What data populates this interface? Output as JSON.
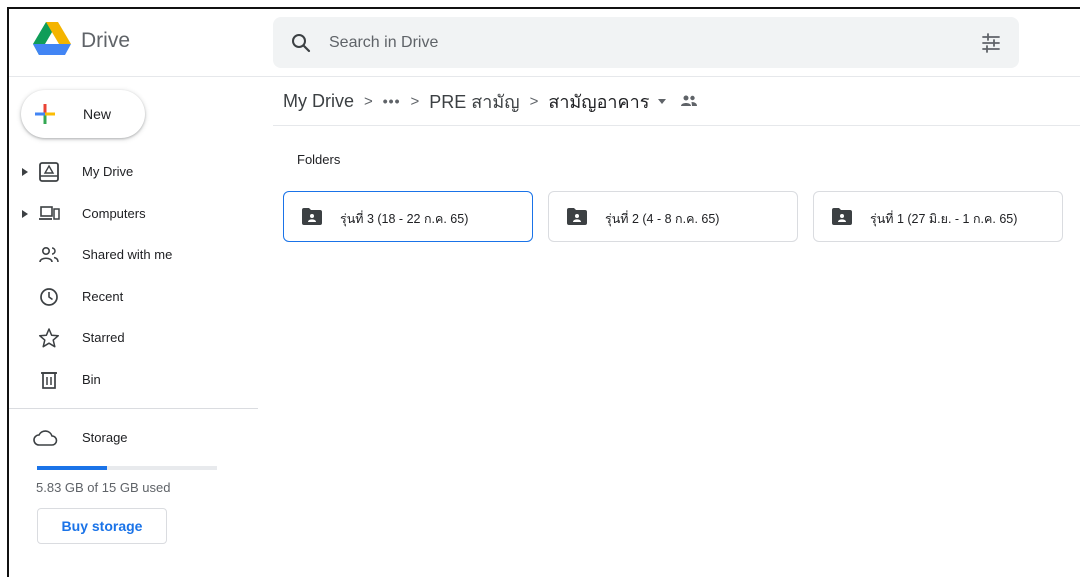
{
  "app": {
    "name": "Drive"
  },
  "search": {
    "placeholder": "Search in Drive"
  },
  "new_button": {
    "label": "New"
  },
  "sidebar": {
    "items": [
      {
        "label": "My Drive",
        "icon": "my-drive-icon",
        "expandable": true
      },
      {
        "label": "Computers",
        "icon": "computers-icon",
        "expandable": true
      },
      {
        "label": "Shared with me",
        "icon": "shared-icon",
        "expandable": false
      },
      {
        "label": "Recent",
        "icon": "clock-icon",
        "expandable": false
      },
      {
        "label": "Starred",
        "icon": "star-icon",
        "expandable": false
      },
      {
        "label": "Bin",
        "icon": "bin-icon",
        "expandable": false
      }
    ]
  },
  "storage": {
    "label": "Storage",
    "usage_text": "5.83 GB of 15 GB used",
    "used_fraction": 0.389,
    "buy_label": "Buy storage"
  },
  "breadcrumb": {
    "root": "My Drive",
    "ellipsis": "•••",
    "parent": "PRE สามัญ",
    "current": "สามัญอาคาร"
  },
  "folders_section": {
    "title": "Folders",
    "folders": [
      {
        "name": "รุ่นที่ 3 (18 - 22 ก.ค. 65)",
        "selected": true
      },
      {
        "name": "รุ่นที่ 2 (4 - 8 ก.ค. 65)",
        "selected": false
      },
      {
        "name": "รุ่นที่ 1 (27 มิ.ย. - 1 ก.ค. 65)",
        "selected": false
      }
    ]
  },
  "colors": {
    "accent": "#1a73e8",
    "search_bg": "#f1f3f4",
    "logo_green": "#0f9d58",
    "logo_yellow": "#f4b400",
    "logo_blue": "#4285f4"
  }
}
